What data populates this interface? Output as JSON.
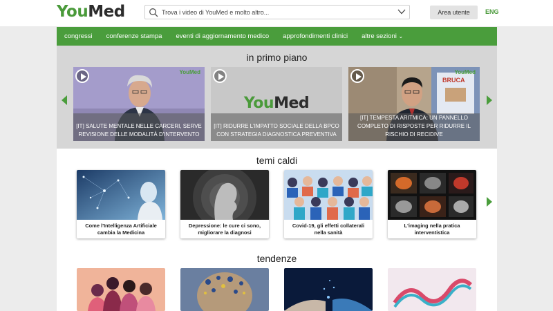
{
  "header": {
    "logo_you": "You",
    "logo_med": "Med",
    "search_placeholder": "Trova i video di YouMed e molto altro...",
    "user_button": "Area utente",
    "lang": "ENG"
  },
  "nav": {
    "items": [
      "congressi",
      "conferenze stampa",
      "eventi di aggiornamento medico",
      "approfondimenti clinici",
      "altre sezioni"
    ]
  },
  "featured": {
    "title": "in primo piano",
    "cards": [
      {
        "caption": "[IT] SALUTE MENTALE NELLE CARCERI, SERVE REVISIONE DELLE MODALITÀ D'INTERVENTO",
        "watermark": "YouMed"
      },
      {
        "caption": "[IT] RIDURRE L'IMPATTO SOCIALE DELLA BPCO CON STRATEGIA DIAGNOSTICA PREVENTIVA",
        "logo_you": "You",
        "logo_med": "Med"
      },
      {
        "caption": "[IT] TEMPESTA ARITMICA: UN PANNELLO COMPLETO DI RISPOSTE PER RIDURRE IL RISCHIO DI RECIDIVE",
        "watermark": "YouMed"
      }
    ]
  },
  "hot": {
    "title": "temi caldi",
    "cards": [
      {
        "label": "Come l'Intelligenza Artificiale cambia la Medicina"
      },
      {
        "label": "Depressione: le cure ci sono, migliorare la diagnosi"
      },
      {
        "label": "Covid-19, gli effetti collaterali nella sanità"
      },
      {
        "label": "L'imaging nella pratica interventistica"
      }
    ]
  },
  "trends": {
    "title": "tendenze"
  },
  "colors": {
    "brand_green": "#4a9d3c",
    "header_bg": "#ffffff",
    "featured_bg": "#d6d6d6",
    "page_bg": "#ececec"
  },
  "icons": {
    "search": "search-icon",
    "dropdown": "chevron-down-icon",
    "play": "play-icon",
    "prev": "arrow-left-icon",
    "next": "arrow-right-icon"
  }
}
